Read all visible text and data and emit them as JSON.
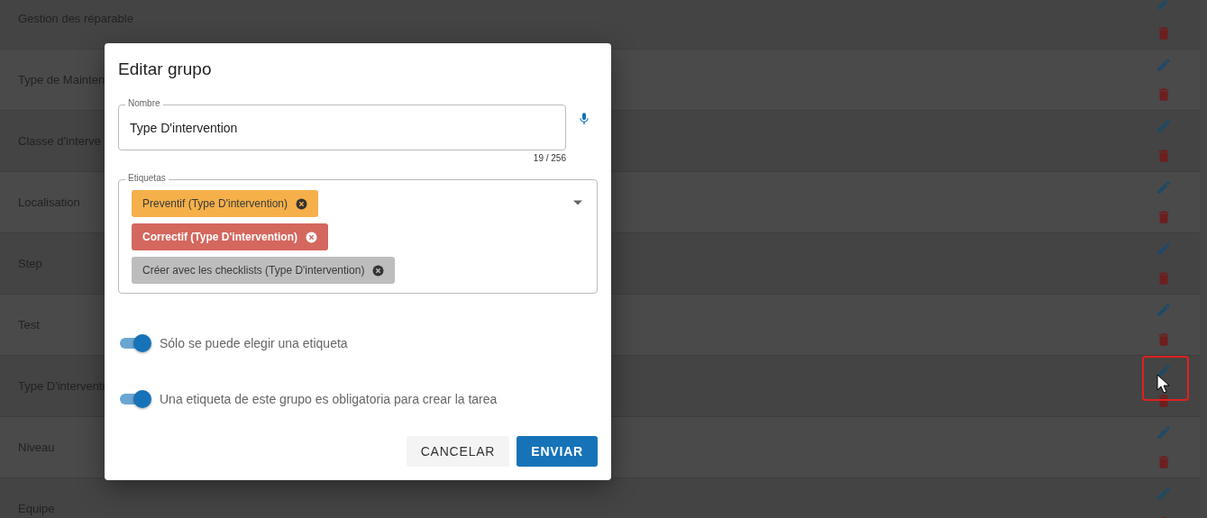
{
  "list": {
    "rows": [
      {
        "name": "Gestion des réparable",
        "highlighted": false
      },
      {
        "name": "Type de Mainten",
        "highlighted": false
      },
      {
        "name": "Classe d'interve",
        "highlighted": false
      },
      {
        "name": "Localisation",
        "highlighted": false
      },
      {
        "name": "Step",
        "highlighted": false
      },
      {
        "name": "Test",
        "highlighted": false
      },
      {
        "name": "Type D'interventi",
        "highlighted": true
      },
      {
        "name": "Niveau",
        "highlighted": false
      },
      {
        "name": "Equipe",
        "highlighted": false
      }
    ]
  },
  "dialog": {
    "title": "Editar grupo",
    "name_field": {
      "label": "Nombre",
      "value": "Type D'intervention",
      "counter": "19 / 256"
    },
    "tags_field": {
      "label": "Etiquetas",
      "chips": [
        {
          "label": "Preventif (Type D'intervention)",
          "color": "#f5b04a"
        },
        {
          "label": "Correctif (Type D'intervention)",
          "color": "#d4675e"
        },
        {
          "label": "Créer avec les checklists (Type D'intervention)",
          "color": "#bdbdbd"
        }
      ]
    },
    "switches": [
      {
        "label": "Sólo se puede elegir una etiqueta",
        "on": true
      },
      {
        "label": "Una etiqueta de este grupo es obligatoria para crear la tarea",
        "on": true
      }
    ],
    "buttons": [
      {
        "label": "CANCELAR",
        "kind": "text"
      },
      {
        "label": "ENVIAR",
        "kind": "primary"
      }
    ]
  }
}
